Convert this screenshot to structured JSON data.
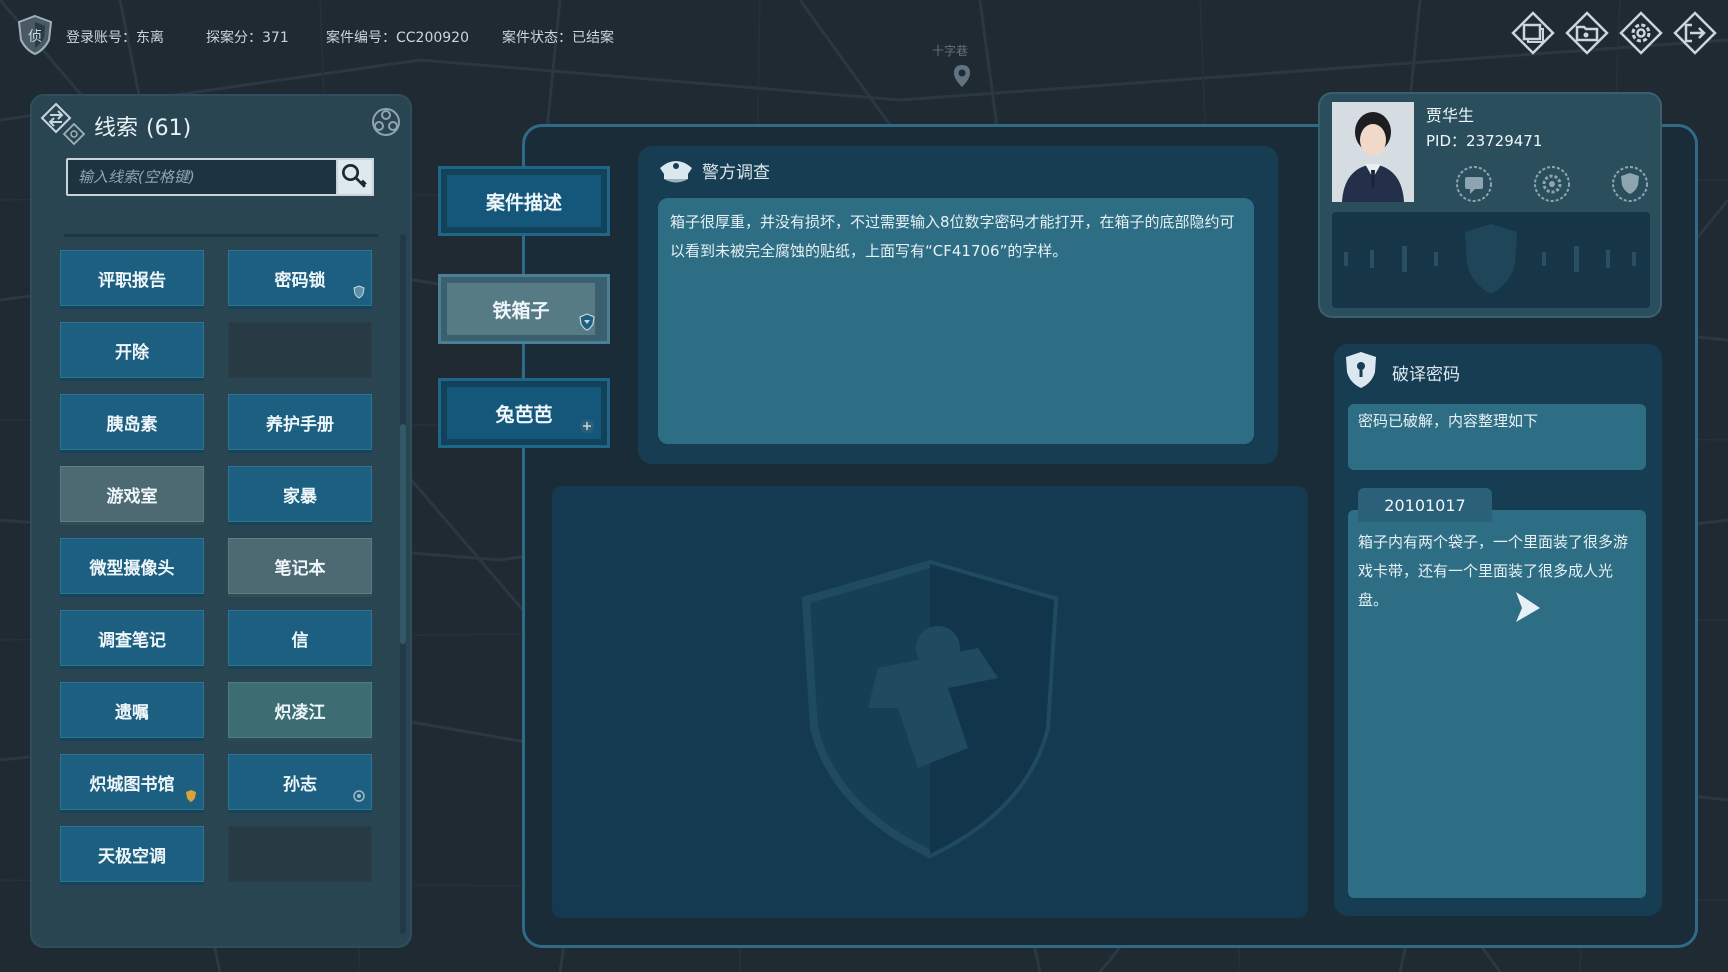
{
  "top_bar": {
    "login_label": "登录账号：",
    "login_value": "东离",
    "score_label": "探案分：",
    "score_value": "371",
    "case_no_label": "案件编号：",
    "case_no_value": "CC200920",
    "status_label": "案件状态：",
    "status_value": "已结案",
    "map_label": "十字巷",
    "icons": [
      "window-icon",
      "case-folder-icon",
      "settings-gear-icon",
      "exit-icon"
    ]
  },
  "clues": {
    "title": "线索",
    "count": "(61)",
    "search_placeholder": "输入线索(空格键)",
    "items": [
      {
        "label": "评职报告",
        "style": "blue",
        "badge": ""
      },
      {
        "label": "密码锁",
        "style": "blue",
        "badge": "shield"
      },
      {
        "label": "开除",
        "style": "blue",
        "badge": ""
      },
      {
        "label": "",
        "style": "empty",
        "badge": ""
      },
      {
        "label": "胰岛素",
        "style": "blue",
        "badge": ""
      },
      {
        "label": "养护手册",
        "style": "blue",
        "badge": ""
      },
      {
        "label": "游戏室",
        "style": "grey",
        "badge": ""
      },
      {
        "label": "家暴",
        "style": "blue",
        "badge": ""
      },
      {
        "label": "微型摄像头",
        "style": "blue",
        "badge": ""
      },
      {
        "label": "笔记本",
        "style": "grey",
        "badge": ""
      },
      {
        "label": "调查笔记",
        "style": "blue",
        "badge": ""
      },
      {
        "label": "信",
        "style": "blue",
        "badge": ""
      },
      {
        "label": "遗嘱",
        "style": "blue",
        "badge": ""
      },
      {
        "label": "炽凌江",
        "style": "teal",
        "badge": ""
      },
      {
        "label": "炽城图书馆",
        "style": "blue",
        "badge": "gold-shield"
      },
      {
        "label": "孙志",
        "style": "blue",
        "badge": "eye"
      },
      {
        "label": "天极空调",
        "style": "blue",
        "badge": ""
      },
      {
        "label": "",
        "style": "empty",
        "badge": ""
      }
    ]
  },
  "tabs": [
    {
      "label": "案件描述",
      "state": "normal"
    },
    {
      "label": "铁箱子",
      "state": "active"
    },
    {
      "label": "兔芭芭",
      "state": "normal"
    }
  ],
  "police": {
    "title": "警方调查",
    "text": "箱子很厚重，并没有损坏，不过需要输入8位数字密码才能打开，在箱子的底部隐约可以看到未被完全腐蚀的贴纸，上面写有“CF41706”的字样。"
  },
  "profile": {
    "name": "贾华生",
    "pid_label": "PID：",
    "pid_value": "23729471",
    "actions": [
      "chat-icon",
      "badge-gear-icon",
      "shield-icon"
    ]
  },
  "decrypt": {
    "title": "破译密码",
    "status": "密码已破解，内容整理如下",
    "code": "20101017",
    "content": "箱子内有两个袋子，一个里面装了很多游戏卡带，还有一个里面装了很多成人光盘。"
  },
  "colors": {
    "accent_blue": "#1c5f80",
    "panel": "#2a4552",
    "frame_border": "#2f6a86",
    "text_box": "#2e6e85"
  }
}
